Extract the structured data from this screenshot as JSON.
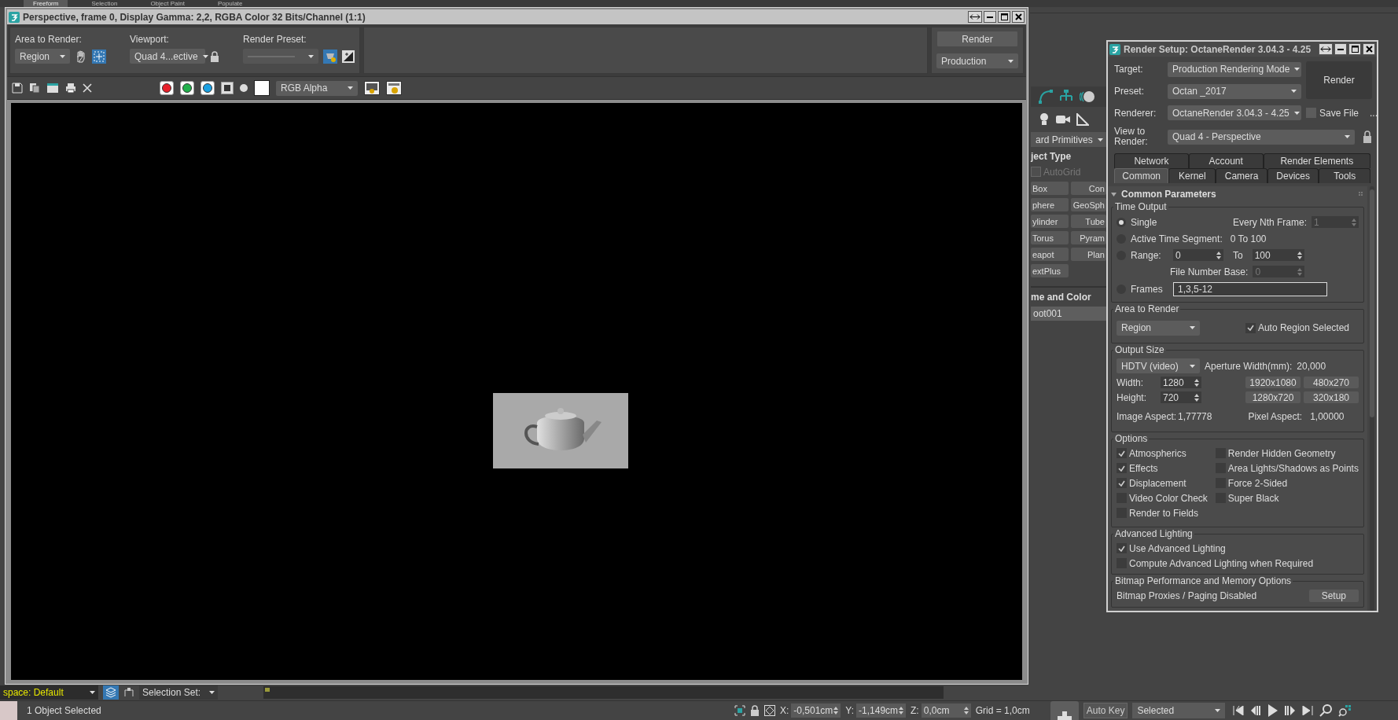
{
  "ribbon_tabs": [
    {
      "label": "Freeform",
      "selected": true
    },
    {
      "label": "Selection",
      "selected": false
    },
    {
      "label": "Object Paint",
      "selected": false
    },
    {
      "label": "Populate",
      "selected": false
    }
  ],
  "frame_window": {
    "title": "Perspective, frame 0, Display Gamma: 2,2, RGBA Color 32 Bits/Channel (1:1)",
    "area_to_render": {
      "label": "Area to Render:",
      "value": "Region"
    },
    "viewport": {
      "label": "Viewport:",
      "value": "Quad 4...ective"
    },
    "render_preset": {
      "label": "Render Preset:"
    },
    "render_button": "Render",
    "render_mode": "Production",
    "channels": [
      {
        "color": "#e8212b"
      },
      {
        "color": "#22b14c"
      },
      {
        "color": "#1ba1e2"
      }
    ],
    "display_channel": "RGB Alpha"
  },
  "command_panel": {
    "category": "ard Primitives",
    "object_type_title": "ject Type",
    "autogrid": {
      "label": "AutoGrid",
      "checked": false,
      "disabled": true
    },
    "buttons": [
      "Box",
      "Con",
      "phere",
      "GeoSph",
      "ylinder",
      "Tube",
      "Torus",
      "Pyram",
      "eapot",
      "Plan",
      "extPlus"
    ],
    "name_color_title": "me and Color",
    "name": "oot001"
  },
  "render_setup": {
    "title": "Render Setup: OctaneRender 3.04.3 - 4.25",
    "fields": [
      {
        "label": "Target:",
        "value": "Production Rendering Mode"
      },
      {
        "label": "Preset:",
        "value": "Octan _2017"
      },
      {
        "label": "Renderer:",
        "value": "OctaneRender 3.04.3 - 4.25"
      }
    ],
    "render_button": "Render",
    "save_file": {
      "label": "Save File",
      "checked": false
    },
    "more": "...",
    "view_to_render": {
      "label": "View to Render:",
      "value": "Quad 4 - Perspective"
    },
    "tab_rows": [
      [
        {
          "label": "Network",
          "selected": false
        },
        {
          "label": "Account",
          "selected": false
        },
        {
          "label": "Render Elements",
          "selected": false
        }
      ],
      [
        {
          "label": "Common",
          "selected": true
        },
        {
          "label": "Kernel",
          "selected": false
        },
        {
          "label": "Camera",
          "selected": false
        },
        {
          "label": "Devices",
          "selected": false
        },
        {
          "label": "Tools",
          "selected": false
        }
      ]
    ],
    "rollout": {
      "title": "Common Parameters",
      "expanded": true
    },
    "time_output": {
      "title": "Time Output",
      "modes": [
        {
          "kind": "single",
          "label": "Single",
          "selected": true
        },
        {
          "kind": "segment",
          "label": "Active Time Segment:",
          "selected": false
        },
        {
          "kind": "range",
          "label": "Range:",
          "selected": false
        },
        {
          "kind": "frames",
          "label": "Frames",
          "selected": false
        }
      ],
      "nth_frame": {
        "label": "Every Nth Frame:",
        "value": "1",
        "disabled": true
      },
      "segment": "0 To 100",
      "range_from": "0",
      "range_to_label": "To",
      "range_to": "100",
      "file_number_base": {
        "label": "File Number Base:",
        "value": "0",
        "disabled": true
      },
      "frames": "1,3,5-12"
    },
    "area_to_render": {
      "title": "Area to Render",
      "value": "Region",
      "auto_region": {
        "label": "Auto Region Selected",
        "checked": true
      }
    },
    "output_size": {
      "title": "Output Size",
      "format": "HDTV (video)",
      "aperture": {
        "label": "Aperture Width(mm):",
        "value": "20,000"
      },
      "width": {
        "label": "Width:",
        "value": "1280"
      },
      "height": {
        "label": "Height:",
        "value": "720"
      },
      "presets": [
        "1920x1080",
        "480x270",
        "1280x720",
        "320x180"
      ],
      "image_aspect": {
        "label": "Image Aspect:",
        "value": "1,77778"
      },
      "pixel_aspect": {
        "label": "Pixel Aspect:",
        "value": "1,00000"
      }
    },
    "options": {
      "title": "Options",
      "items": [
        {
          "label": "Atmospherics",
          "checked": true
        },
        {
          "label": "Render Hidden Geometry",
          "checked": false
        },
        {
          "label": "Effects",
          "checked": true
        },
        {
          "label": "Area Lights/Shadows as Points",
          "checked": false
        },
        {
          "label": "Displacement",
          "checked": true
        },
        {
          "label": "Force 2-Sided",
          "checked": false
        },
        {
          "label": "Video Color Check",
          "checked": false
        },
        {
          "label": "Super Black",
          "checked": false
        },
        {
          "label": "Render to Fields",
          "checked": false
        }
      ]
    },
    "advanced_lighting": {
      "title": "Advanced Lighting",
      "items": [
        {
          "label": "Use Advanced Lighting",
          "checked": true
        },
        {
          "label": "Compute Advanced Lighting when Required",
          "checked": false
        }
      ]
    },
    "bitmap": {
      "title": "Bitmap Performance and Memory Options",
      "status": "Bitmap Proxies / Paging Disabled",
      "button": "Setup"
    }
  },
  "bottom": {
    "workspace": "space: Default",
    "selection_set": "Selection Set:",
    "status": "1 Object Selected",
    "coords": [
      {
        "label": "X:",
        "value": "-0,501cm"
      },
      {
        "label": "Y:",
        "value": "-1,149cm"
      },
      {
        "label": "Z:",
        "value": "0,0cm"
      }
    ],
    "grid": "Grid = 1,0cm",
    "auto_key": "Auto Key",
    "key_filter": "Selected"
  }
}
